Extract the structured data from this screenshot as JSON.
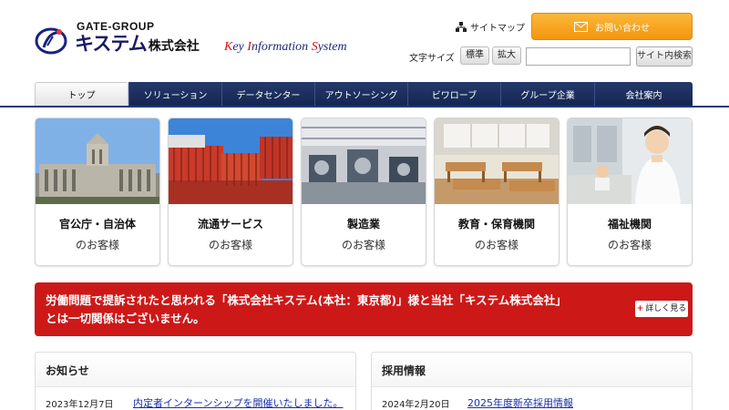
{
  "header": {
    "logo_group": "GATE-GROUP",
    "logo_name": "キステム",
    "logo_suffix": "株式会社",
    "tagline_k": "K",
    "tagline_ey": "ey ",
    "tagline_i": "I",
    "tagline_nformation": "nformation ",
    "tagline_s": "S",
    "tagline_ystem": "ystem",
    "sitemap_label": "サイトマップ",
    "contact_label": "お問い合わせ",
    "font_size_label": "文字サイズ",
    "font_standard": "標準",
    "font_large": "拡大",
    "search_placeholder": "",
    "search_button": "サイト内検索"
  },
  "nav": {
    "items": [
      {
        "label": "トップ"
      },
      {
        "label": "ソリューション"
      },
      {
        "label": "データセンター"
      },
      {
        "label": "アウトソーシング"
      },
      {
        "label": "ビワローブ"
      },
      {
        "label": "グループ企業"
      },
      {
        "label": "会社案内"
      }
    ]
  },
  "categories": [
    {
      "title": "官公庁・自治体",
      "sub": "のお客様"
    },
    {
      "title": "流通サービス",
      "sub": "のお客様"
    },
    {
      "title": "製造業",
      "sub": "のお客様"
    },
    {
      "title": "教育・保育機関",
      "sub": "のお客様"
    },
    {
      "title": "福祉機関",
      "sub": "のお客様"
    }
  ],
  "alert": {
    "line1": "労働問題で提訴されたと思われる「株式会社キステム(本社：東京都)」様と当社「キステム株式会社」",
    "line2": "とは一切関係はございません。",
    "more_icon": "+",
    "more_label": "詳しく見る"
  },
  "news": {
    "title": "お知らせ",
    "date": "2023年12月7日",
    "link": "内定者インターンシップを開催いたしました。"
  },
  "recruit": {
    "title": "採用情報",
    "date": "2024年2月20日",
    "link": "2025年度新卒採用情報"
  },
  "colors": {
    "nav_bg": "#1c2f5e",
    "contact_bg": "#f5a623",
    "alert_bg": "#cd1818",
    "link": "#1a2faa"
  }
}
